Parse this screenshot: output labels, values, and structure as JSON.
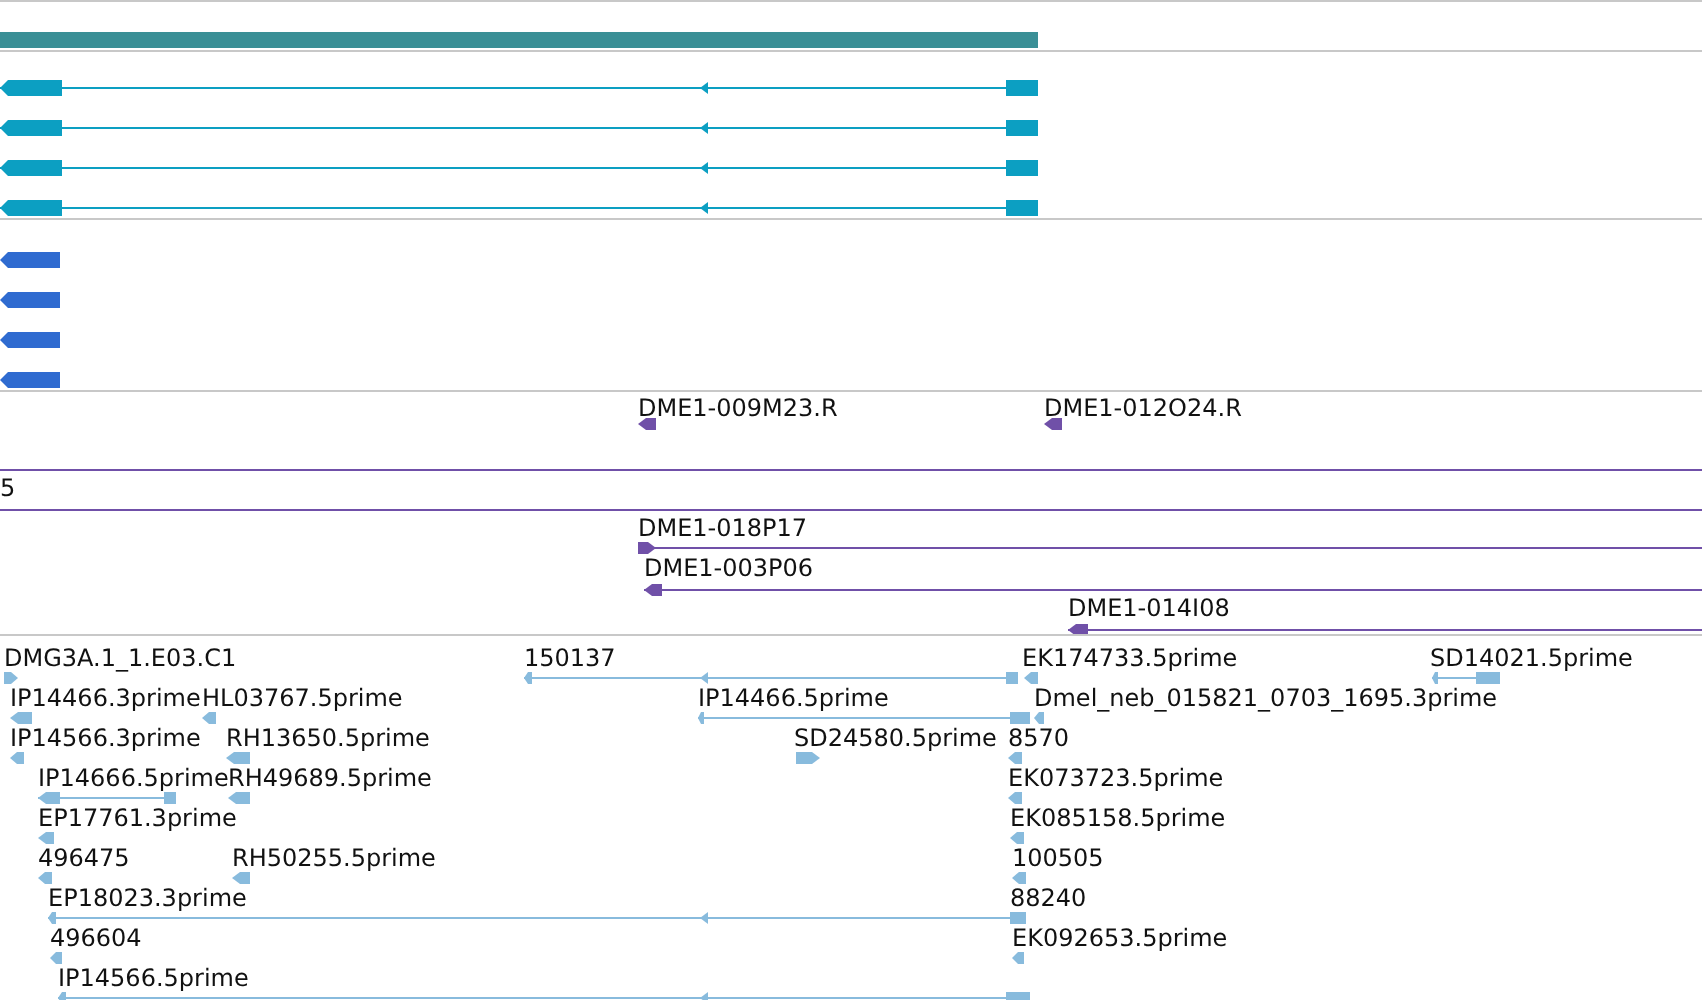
{
  "tracks": [
    {
      "kind": "coverage"
    },
    {
      "kind": "transcripts",
      "features": [
        {
          "reverse": true
        },
        {
          "reverse": true
        },
        {
          "reverse": true
        },
        {
          "reverse": true
        }
      ]
    },
    {
      "kind": "exons",
      "features": [
        {
          "reverse": true
        },
        {
          "reverse": true
        },
        {
          "reverse": true
        },
        {
          "reverse": true
        }
      ]
    },
    {
      "kind": "clones",
      "features": [
        {
          "kind": "clone",
          "label": "DME1-009M23.R",
          "reverse": true
        },
        {
          "kind": "clone",
          "label": "DME1-012O24.R",
          "reverse": true
        },
        {
          "kind": "span"
        },
        {
          "kind": "span",
          "label": "5"
        },
        {
          "kind": "clone",
          "label": "DME1-018P17",
          "reverse": false
        },
        {
          "kind": "clone",
          "label": "DME1-003P06",
          "reverse": true
        },
        {
          "kind": "clone",
          "label": "DME1-014I08",
          "reverse": true
        }
      ]
    },
    {
      "kind": "ests",
      "features": [
        {
          "label": "DMG3A.1_1.E03.C1",
          "reverse": false
        },
        {
          "label": "150137",
          "reverse": true
        },
        {
          "label": "EK174733.5prime",
          "reverse": true
        },
        {
          "label": "SD14021.5prime",
          "reverse": true
        },
        {
          "label": "IP14466.3prime",
          "reverse": true
        },
        {
          "label": "HL03767.5prime",
          "reverse": true
        },
        {
          "label": "IP14466.5prime",
          "reverse": true
        },
        {
          "label": "Dmel_neb_015821_0703_1695.3prime",
          "reverse": true
        },
        {
          "label": "IP14566.3prime",
          "reverse": true
        },
        {
          "label": "RH13650.5prime",
          "reverse": true
        },
        {
          "label": "SD24580.5prime",
          "reverse": false
        },
        {
          "label": "8570",
          "reverse": true
        },
        {
          "label": "IP14666.5prime",
          "reverse": true
        },
        {
          "label": "RH49689.5prime",
          "reverse": true
        },
        {
          "label": "EK073723.5prime",
          "reverse": true
        },
        {
          "label": "EP17761.3prime",
          "reverse": true
        },
        {
          "label": "EK085158.5prime",
          "reverse": true
        },
        {
          "label": "496475",
          "reverse": true
        },
        {
          "label": "RH50255.5prime",
          "reverse": true
        },
        {
          "label": "100505",
          "reverse": true
        },
        {
          "label": "EP18023.3prime",
          "reverse": true
        },
        {
          "label": "88240"
        },
        {
          "label": "496604",
          "reverse": true
        },
        {
          "label": "EK092653.5prime",
          "reverse": true
        },
        {
          "label": "IP14566.5prime",
          "reverse": true
        }
      ]
    }
  ]
}
